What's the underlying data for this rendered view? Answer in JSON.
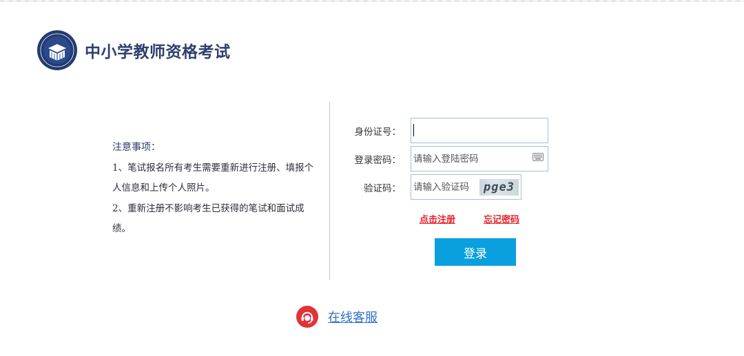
{
  "header": {
    "title": "中小学教师资格考试"
  },
  "notice": {
    "title": "注意事项：",
    "items": [
      "1、笔试报名所有考生需要重新进行注册、填报个人信息和上传个人照片。",
      "2、重新注册不影响考生已获得的笔试和面试成绩。"
    ]
  },
  "login_form": {
    "id_label": "身份证号：",
    "id_value": "",
    "password_label": "登录密码：",
    "password_placeholder": "请输入登陆密码",
    "captcha_label": "验证码：",
    "captcha_placeholder": "请输入验证码",
    "captcha_text": "pge3",
    "register_link": "点击注册",
    "forgot_link": "忘记密码",
    "submit_label": "登录"
  },
  "footer": {
    "service_label": "在线客服"
  },
  "colors": {
    "brand_navy": "#2c3f6e",
    "button_blue": "#0aa0e0",
    "link_red": "#e8212a",
    "service_red": "#e0343a"
  }
}
